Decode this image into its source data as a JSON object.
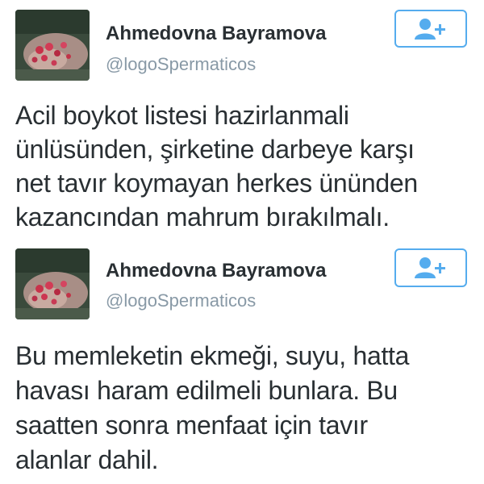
{
  "accent_color": "#55acee",
  "tweets": [
    {
      "author_name": "Ahmedovna Bayramova",
      "author_handle": "@logoSpermaticos",
      "follow_icon": "add-user-icon",
      "text": "Acil boykot listesi hazirlanmali\nünlüsünden,  şirketine darbeye karşı\nnet tavır koymayan herkes ününden\nkazancından mahrum bırakılmalı."
    },
    {
      "author_name": "Ahmedovna Bayramova",
      "author_handle": "@logoSpermaticos",
      "follow_icon": "add-user-icon",
      "text": "Bu memleketin ekmeği, suyu, hatta\nhavası haram edilmeli bunlara. Bu\nsaatten sonra menfaat için tavır\nalanlar dahil."
    }
  ]
}
